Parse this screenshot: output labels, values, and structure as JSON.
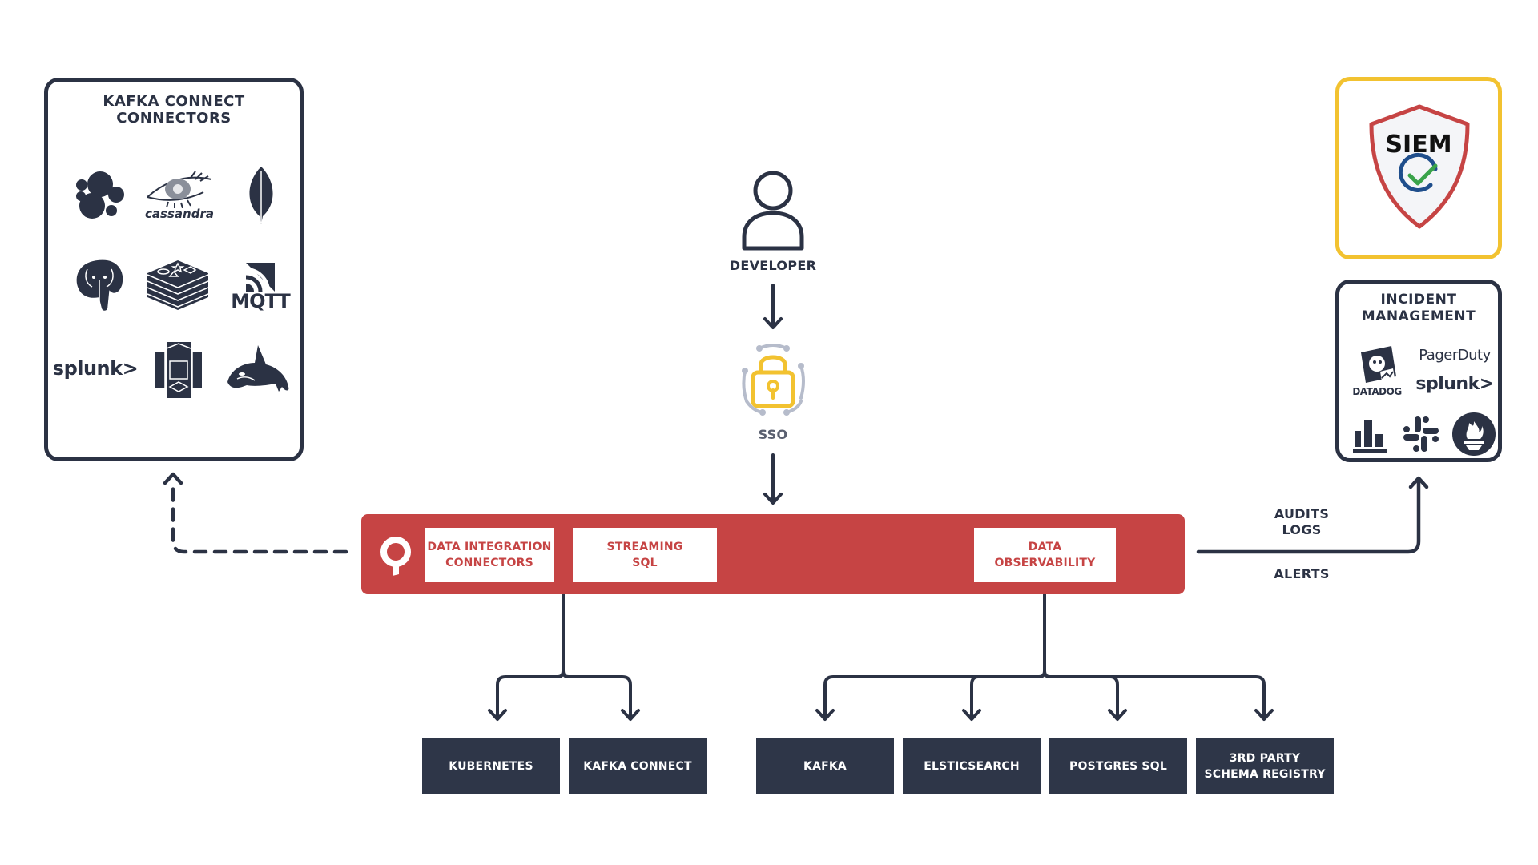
{
  "connectors_panel": {
    "title": "KAFKA CONNECT\nCONNECTORS",
    "logos": [
      {
        "name": "elasticsearch-icon"
      },
      {
        "name": "cassandra-logo",
        "text": "cassandra"
      },
      {
        "name": "mongodb-leaf-icon"
      },
      {
        "name": "postgresql-elephant-icon"
      },
      {
        "name": "redis-stack-icon"
      },
      {
        "name": "mqtt-logo",
        "text": "MQTT"
      },
      {
        "name": "splunk-logo",
        "text": "splunk>"
      },
      {
        "name": "amazon-s3-icon"
      },
      {
        "name": "orca-whale-icon"
      }
    ]
  },
  "developer": {
    "label": "DEVELOPER",
    "icon": "user-icon"
  },
  "sso": {
    "label": "SSO",
    "icon": "padlock-icon"
  },
  "platform": {
    "logo_icon": "lenses-logo-icon",
    "modules": [
      {
        "label": "DATA INTEGRATION\nCONNECTORS"
      },
      {
        "label": "STREAMING\nSQL"
      },
      {
        "label": "DATA\nOBSERVABILITY"
      }
    ]
  },
  "siem": {
    "label": "SIEM",
    "icon": "shield-check-icon"
  },
  "incident_panel": {
    "title": "INCIDENT\nMANAGEMENT",
    "logos": [
      {
        "name": "datadog-logo",
        "text": "DATADOG"
      },
      {
        "name": "pagerduty-logo",
        "text": "PagerDuty"
      },
      {
        "name": "splunk-logo",
        "text": "splunk>"
      },
      {
        "name": "bar-chart-icon"
      },
      {
        "name": "slack-icon"
      },
      {
        "name": "prometheus-icon"
      }
    ]
  },
  "edge_labels": {
    "audits_logs": "AUDITS\nLOGS",
    "alerts": "ALERTS"
  },
  "targets": {
    "integration": [
      {
        "label": "KUBERNETES"
      },
      {
        "label": "KAFKA CONNECT"
      }
    ],
    "observability": [
      {
        "label": "KAFKA"
      },
      {
        "label": "ELSTICSEARCH"
      },
      {
        "label": "POSTGRES SQL"
      },
      {
        "label": "3RD PARTY\nSCHEMA REGISTRY"
      }
    ]
  },
  "colors": {
    "navy": "#2b3244",
    "brand_red": "#c64444",
    "siem_border": "#f2c230",
    "sso_lock": "#f2c230"
  }
}
